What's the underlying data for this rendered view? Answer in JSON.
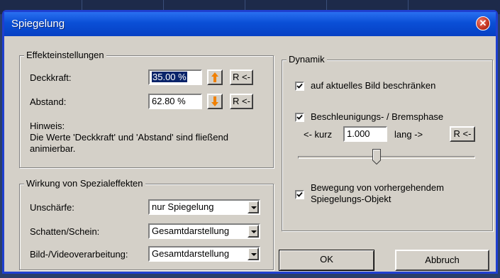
{
  "window": {
    "title": "Spiegelung"
  },
  "effect_settings": {
    "legend": "Effekteinstellungen",
    "opacity_label": "Deckkraft:",
    "opacity_value": "35.00 %",
    "distance_label": "Abstand:",
    "distance_value": "62.80 %",
    "reset_label": "R <-",
    "hint_title": "Hinweis:",
    "hint_text": "Die Werte 'Deckkraft' und 'Abstand' sind fließend animierbar."
  },
  "special_effects": {
    "legend": "Wirkung von Spezialeffekten",
    "blur_label": "Unschärfe:",
    "blur_value": "nur Spiegelung",
    "shadow_label": "Schatten/Schein:",
    "shadow_value": "Gesamtdarstellung",
    "video_label": "Bild-/Videoverarbeitung:",
    "video_value": "Gesamtdarstellung"
  },
  "dynamics": {
    "legend": "Dynamik",
    "restrict_label": "auf aktuelles Bild beschränken",
    "restrict_checked": true,
    "accel_label": "Beschleunigungs- / Bremsphase",
    "accel_checked": true,
    "short_label": "<- kurz",
    "phase_value": "1.000",
    "long_label": "lang ->",
    "reset_label": "R <-",
    "slider_level": 0.44,
    "motion_label": "Bewegung von vorhergehendem Spiegelungs-Objekt",
    "motion_checked": true
  },
  "buttons": {
    "ok": "OK",
    "cancel": "Abbruch"
  },
  "colors": {
    "title_bar": "#0a4fd6",
    "arrow_orange": "#f08000",
    "selection": "#0a246a"
  }
}
